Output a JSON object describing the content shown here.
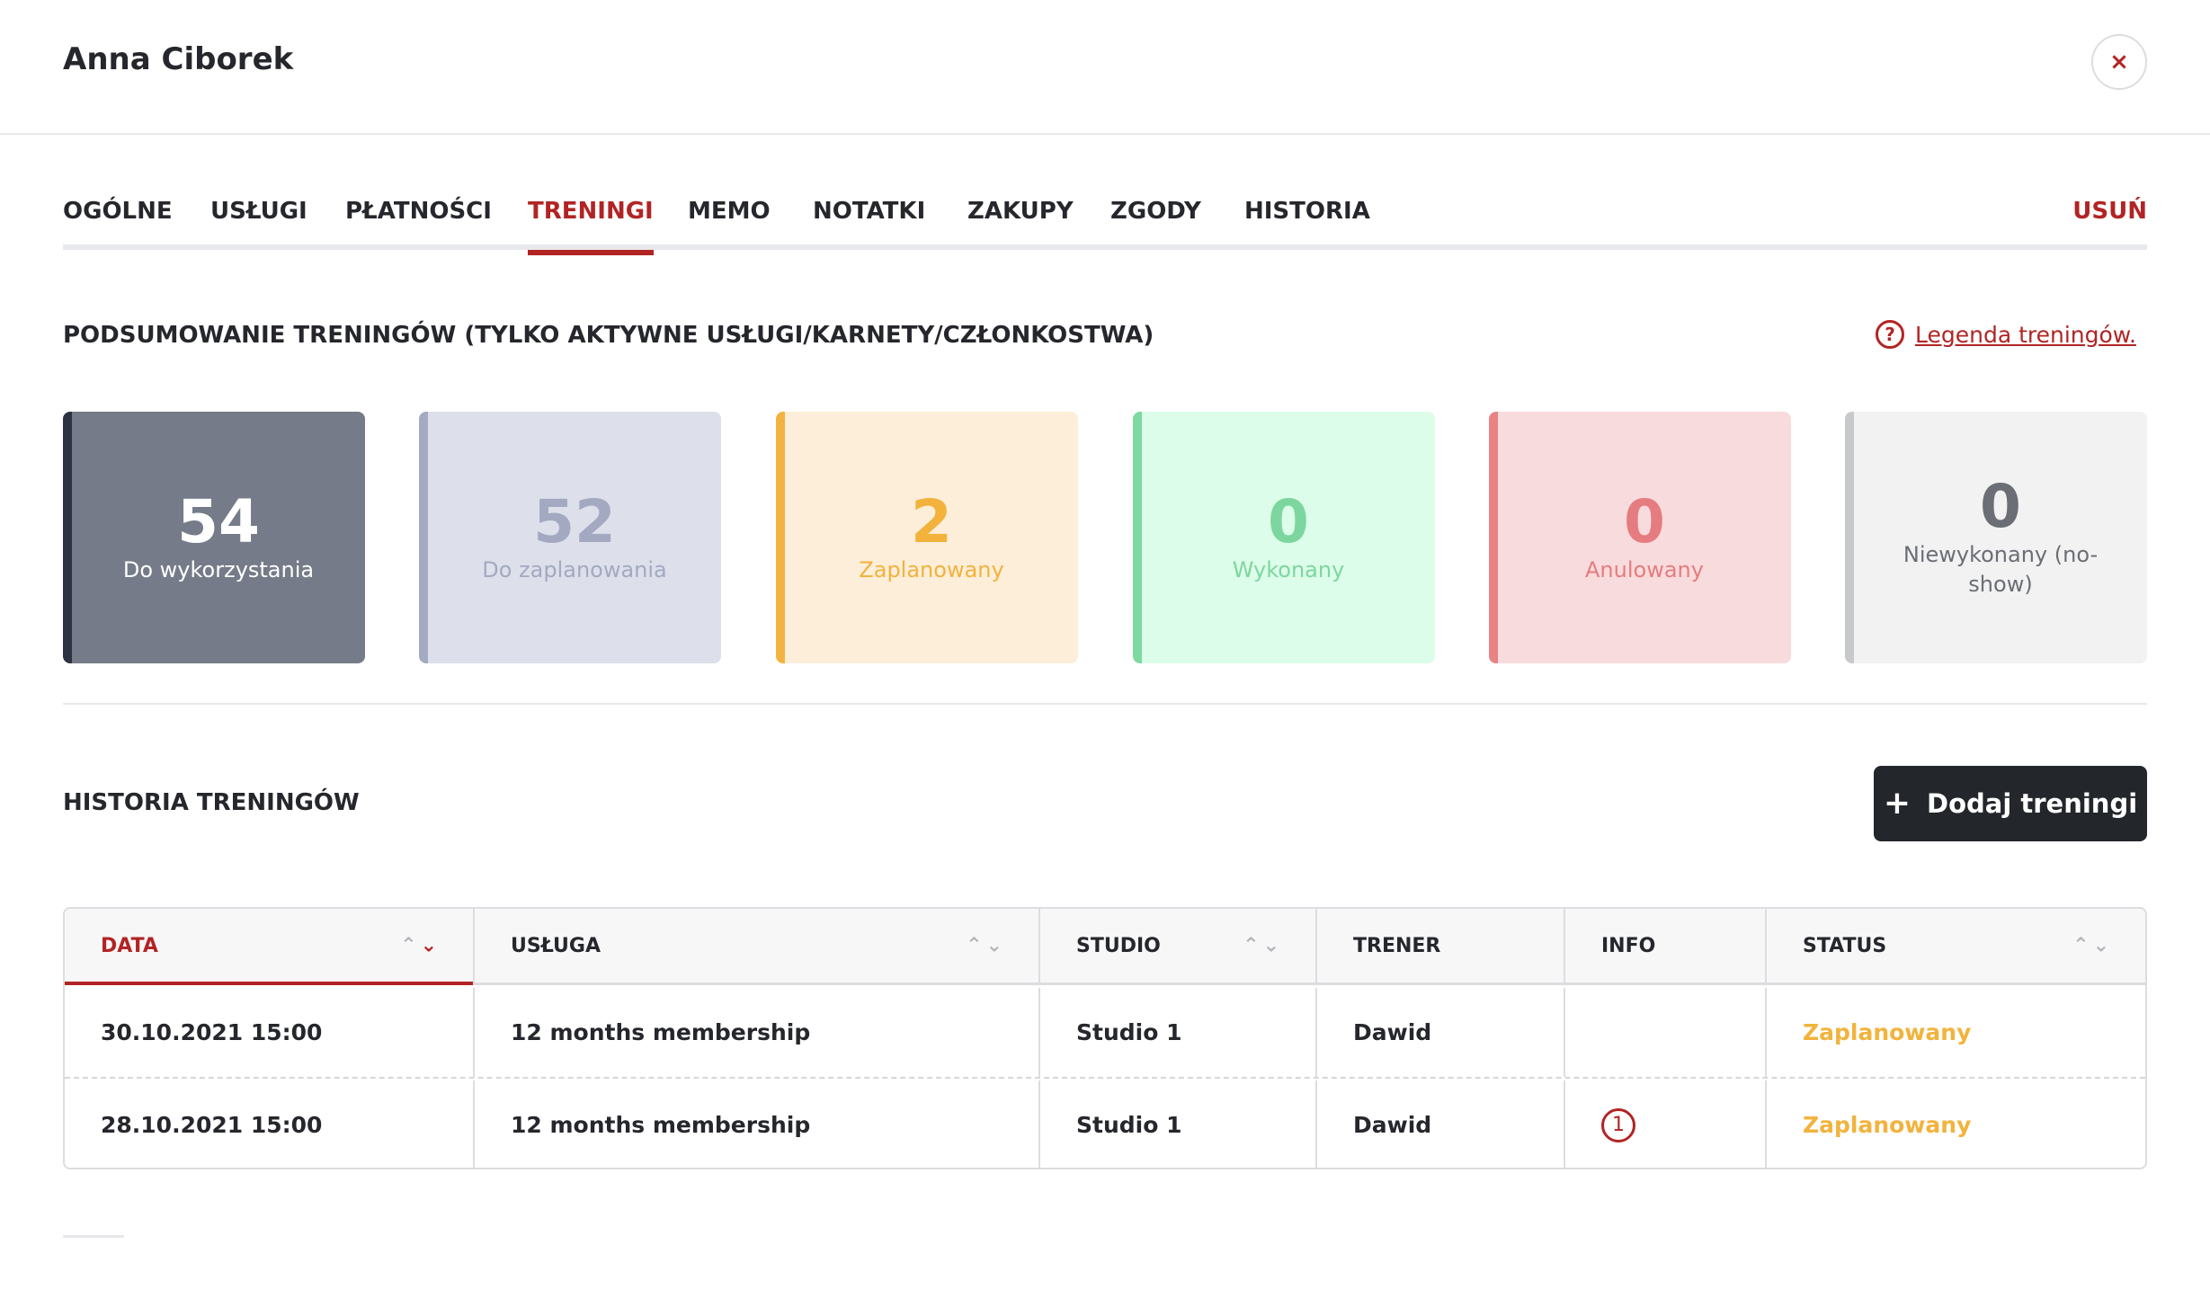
{
  "header": {
    "title": "Anna Ciborek",
    "close_icon": "×"
  },
  "tabs": [
    {
      "label": "OGÓLNE",
      "active": false
    },
    {
      "label": "USŁUGI",
      "active": false
    },
    {
      "label": "PŁATNOŚCI",
      "active": false
    },
    {
      "label": "TRENINGI",
      "active": true
    },
    {
      "label": "MEMO",
      "active": false
    },
    {
      "label": "NOTATKI",
      "active": false
    },
    {
      "label": "ZAKUPY",
      "active": false
    },
    {
      "label": "ZGODY",
      "active": false
    },
    {
      "label": "HISTORIA",
      "active": false
    }
  ],
  "delete_tab": "USUŃ",
  "summary": {
    "title": "PODSUMOWANIE TRENINGÓW (TYLKO AKTYWNE USŁUGI/KARNETY/CZŁONKOSTWA)",
    "legend_icon": "?",
    "legend_link": "Legenda treningów.",
    "cards": [
      {
        "value": "54",
        "label": "Do wykorzystania",
        "bg": "#757b88",
        "border": "#2c3242",
        "color": "#ffffff"
      },
      {
        "value": "52",
        "label": "Do zaplanowania",
        "bg": "#dde0ea",
        "border": "#a4aac2",
        "color": "#a3a9c1"
      },
      {
        "value": "2",
        "label": "Zaplanowany",
        "bg": "#fdeed9",
        "border": "#f3b340",
        "color": "#f2b23c"
      },
      {
        "value": "0",
        "label": "Wykonany",
        "bg": "#dcfde9",
        "border": "#7ed9a0",
        "color": "#7dd69f"
      },
      {
        "value": "0",
        "label": "Anulowany",
        "bg": "#f8dbdc",
        "border": "#e98285",
        "color": "#e57c80"
      },
      {
        "value": "0",
        "label": "Niewykonany (no-show)",
        "bg": "#f2f2f3",
        "border": "#c6c8cc",
        "color": "#6b6e74"
      }
    ]
  },
  "history": {
    "title": "HISTORIA TRENINGÓW",
    "add_button_icon": "+",
    "add_button": "Dodaj treningi",
    "columns": [
      "DATA",
      "USŁUGA",
      "STUDIO",
      "TRENER",
      "INFO",
      "STATUS"
    ],
    "sort_up": "⌃",
    "sort_down": "⌄",
    "rows": [
      {
        "date": "30.10.2021 15:00",
        "service": "12 months membership",
        "studio": "Studio 1",
        "trainer": "Dawid",
        "info": "",
        "status": "Zaplanowany"
      },
      {
        "date": "28.10.2021 15:00",
        "service": "12 months membership",
        "studio": "Studio 1",
        "trainer": "Dawid",
        "info": "1",
        "status": "Zaplanowany"
      }
    ]
  }
}
